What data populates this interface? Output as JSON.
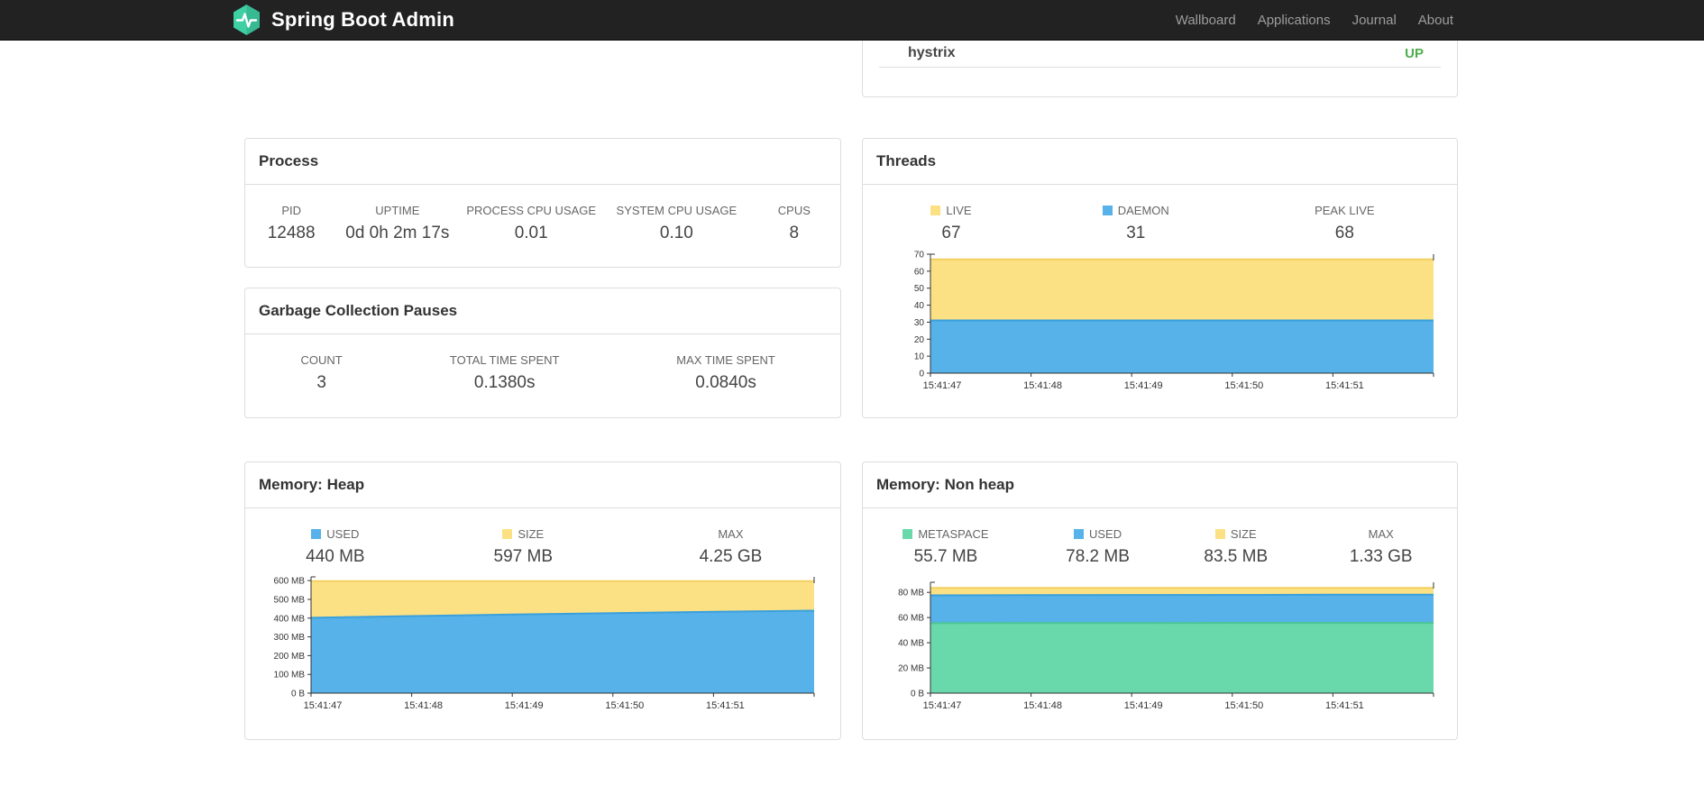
{
  "navbar": {
    "brand": "Spring Boot Admin",
    "links": [
      {
        "label": "Wallboard"
      },
      {
        "label": "Applications"
      },
      {
        "label": "Journal"
      },
      {
        "label": "About"
      }
    ]
  },
  "colors": {
    "yellow": "#fce184",
    "blue": "#56b2e8",
    "green": "#69d9ac",
    "status_up": "#4cae4c"
  },
  "panels": {
    "health": {
      "rows": [
        {
          "name": "hystrix",
          "status": "UP"
        }
      ]
    },
    "process": {
      "title": "Process",
      "metrics": [
        {
          "label": "PID",
          "value": "12488"
        },
        {
          "label": "UPTIME",
          "value": "0d 0h 2m 17s"
        },
        {
          "label": "PROCESS CPU USAGE",
          "value": "0.01"
        },
        {
          "label": "SYSTEM CPU USAGE",
          "value": "0.10"
        },
        {
          "label": "CPUS",
          "value": "8"
        }
      ]
    },
    "gc": {
      "title": "Garbage Collection Pauses",
      "metrics": [
        {
          "label": "COUNT",
          "value": "3"
        },
        {
          "label": "TOTAL TIME SPENT",
          "value": "0.1380s"
        },
        {
          "label": "MAX TIME SPENT",
          "value": "0.0840s"
        }
      ]
    },
    "threads": {
      "title": "Threads",
      "metrics": [
        {
          "label": "LIVE",
          "value": "67",
          "color": "#fce184"
        },
        {
          "label": "DAEMON",
          "value": "31",
          "color": "#56b2e8"
        },
        {
          "label": "PEAK LIVE",
          "value": "68"
        }
      ]
    },
    "heap": {
      "title": "Memory: Heap",
      "metrics": [
        {
          "label": "USED",
          "value": "440 MB",
          "color": "#56b2e8"
        },
        {
          "label": "SIZE",
          "value": "597 MB",
          "color": "#fce184"
        },
        {
          "label": "MAX",
          "value": "4.25 GB"
        }
      ]
    },
    "nonheap": {
      "title": "Memory: Non heap",
      "metrics": [
        {
          "label": "METASPACE",
          "value": "55.7 MB",
          "color": "#69d9ac"
        },
        {
          "label": "USED",
          "value": "78.2 MB",
          "color": "#56b2e8"
        },
        {
          "label": "SIZE",
          "value": "83.5 MB",
          "color": "#fce184"
        },
        {
          "label": "MAX",
          "value": "1.33 GB"
        }
      ]
    }
  },
  "chart_data": [
    {
      "id": "threads",
      "type": "area",
      "title": "Threads",
      "x": [
        "15:41:47",
        "15:41:48",
        "15:41:49",
        "15:41:50",
        "15:41:51"
      ],
      "ymax": 70,
      "yticks": [
        {
          "v": 0,
          "label": "0"
        },
        {
          "v": 10,
          "label": "10"
        },
        {
          "v": 20,
          "label": "20"
        },
        {
          "v": 30,
          "label": "30"
        },
        {
          "v": 40,
          "label": "40"
        },
        {
          "v": 50,
          "label": "50"
        },
        {
          "v": 60,
          "label": "60"
        },
        {
          "v": 70,
          "label": "70"
        }
      ],
      "series": [
        {
          "name": "LIVE",
          "color": "#fce184",
          "stroke": "#f2d061",
          "values": [
            67,
            67,
            67,
            67,
            67,
            67
          ]
        },
        {
          "name": "DAEMON",
          "color": "#56b2e8",
          "stroke": "#3aa0dd",
          "values": [
            31,
            31,
            31,
            31,
            31,
            31
          ]
        }
      ],
      "legend_position": "top",
      "grid": false
    },
    {
      "id": "heap",
      "type": "area",
      "title": "Memory: Heap",
      "x": [
        "15:41:47",
        "15:41:48",
        "15:41:49",
        "15:41:50",
        "15:41:51"
      ],
      "ymax": 620,
      "yticks": [
        {
          "v": 0,
          "label": "0 B"
        },
        {
          "v": 100,
          "label": "100 MB"
        },
        {
          "v": 200,
          "label": "200 MB"
        },
        {
          "v": 300,
          "label": "300 MB"
        },
        {
          "v": 400,
          "label": "400 MB"
        },
        {
          "v": 500,
          "label": "500 MB"
        },
        {
          "v": 600,
          "label": "600 MB"
        }
      ],
      "series": [
        {
          "name": "SIZE",
          "color": "#fce184",
          "stroke": "#f2d061",
          "values": [
            597,
            597,
            597,
            597,
            597,
            597
          ]
        },
        {
          "name": "USED",
          "color": "#56b2e8",
          "stroke": "#3aa0dd",
          "values": [
            402,
            411,
            419,
            427,
            434,
            440
          ]
        }
      ],
      "legend_position": "top",
      "grid": false
    },
    {
      "id": "nonheap",
      "type": "area",
      "title": "Memory: Non heap",
      "x": [
        "15:41:47",
        "15:41:48",
        "15:41:49",
        "15:41:50",
        "15:41:51"
      ],
      "ymax": 88,
      "yticks": [
        {
          "v": 0,
          "label": "0 B"
        },
        {
          "v": 20,
          "label": "20 MB"
        },
        {
          "v": 40,
          "label": "40 MB"
        },
        {
          "v": 60,
          "label": "60 MB"
        },
        {
          "v": 80,
          "label": "80 MB"
        }
      ],
      "series": [
        {
          "name": "SIZE",
          "color": "#fce184",
          "stroke": "#f2d061",
          "values": [
            83.5,
            83.5,
            83.5,
            83.5,
            83.5,
            83.5
          ]
        },
        {
          "name": "USED",
          "color": "#56b2e8",
          "stroke": "#3aa0dd",
          "values": [
            77.6,
            77.8,
            77.9,
            78.0,
            78.1,
            78.2
          ]
        },
        {
          "name": "METASPACE",
          "color": "#69d9ac",
          "stroke": "#4bc795",
          "values": [
            55.5,
            55.6,
            55.6,
            55.7,
            55.7,
            55.7
          ]
        }
      ],
      "legend_position": "top",
      "grid": false
    }
  ]
}
